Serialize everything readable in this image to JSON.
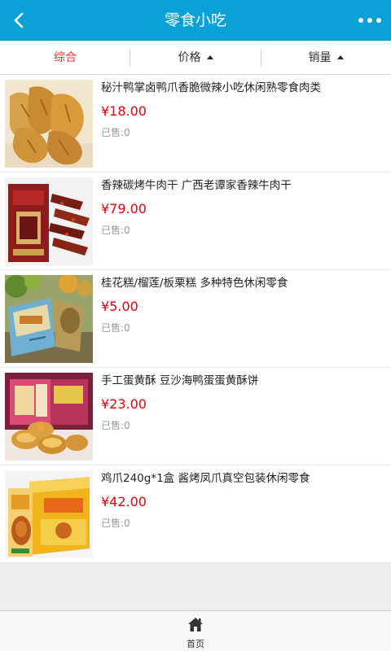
{
  "header": {
    "title": "零食小吃",
    "back_icon": "chevron-left-icon",
    "more_icon": "more-dots-icon"
  },
  "sort_tabs": [
    {
      "label": "综合",
      "active": true
    },
    {
      "label": "价格",
      "arrow": "triangle-up-icon"
    },
    {
      "label": "销量",
      "arrow": "triangle-up-icon"
    }
  ],
  "products": [
    {
      "name": "秘汁鸭掌卤鸭爪香脆微辣小吃休闲熟零食肉类",
      "price": "¥18.00",
      "sold": "已售:0"
    },
    {
      "name": "香辣碳烤牛肉干 广西老谭家香辣牛肉干",
      "price": "¥79.00",
      "sold": "已售:0"
    },
    {
      "name": "桂花糕/榴莲/板栗糕 多种特色休闲零食",
      "price": "¥5.00",
      "sold": "已售:0"
    },
    {
      "name": "手工蛋黄酥 豆沙海鸭蛋蛋黄酥饼",
      "price": "¥23.00",
      "sold": "已售:0"
    },
    {
      "name": "鸡爪240g*1盒 酱烤凤爪真空包装休闲零食",
      "price": "¥42.00",
      "sold": "已售:0"
    }
  ],
  "footer": {
    "home_label": "首页",
    "home_icon": "home-icon"
  },
  "colors": {
    "header_bg": "#0aa1d6",
    "price": "#e4000f",
    "active_tab": "#e33333"
  }
}
